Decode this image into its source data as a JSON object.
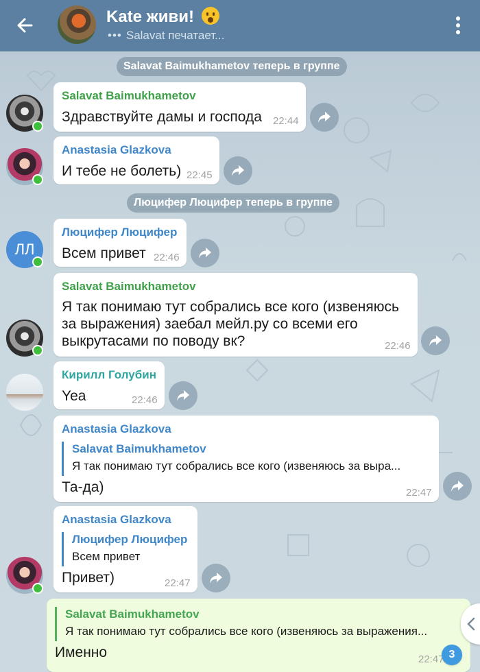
{
  "header": {
    "title": "Kate живи!",
    "status_dots": "•••",
    "status": "Salavat печатает...",
    "colors": {
      "bar": "#5b80a2"
    }
  },
  "service": [
    {
      "text": "Salavat Baimukhametov теперь в группе"
    },
    {
      "text": "Люцифер Люцифер теперь в группе"
    }
  ],
  "messages": [
    {
      "sender": "Salavat Baimukhametov",
      "text": "Здравствуйте дамы и господа",
      "time": "22:44"
    },
    {
      "sender": "Anastasia Glazkova",
      "text": "И тебе не болеть)",
      "time": "22:45"
    },
    {
      "sender": "Люцифер Люцифер",
      "avatar_initials": "ЛЛ",
      "text": "Всем привет",
      "time": "22:46"
    },
    {
      "sender": "Salavat Baimukhametov",
      "lines": [
        "Я так понимаю тут собрались все кого (извеняюсь",
        "за выражения) заебал мейл.ру со всеми его",
        "выкрутасами по поводу вк?"
      ],
      "time": "22:46"
    },
    {
      "sender": "Кирилл Голубин",
      "text": "Yea",
      "time": "22:46"
    },
    {
      "sender": "Anastasia Glazkova",
      "reply_name": "Salavat Baimukhametov",
      "reply_text": "Я так понимаю тут собрались все кого (извеняюсь за выра...",
      "text": "Та-да)",
      "time": "22:47"
    },
    {
      "sender": "Anastasia Glazkova",
      "reply_name": "Люцифер Люцифер",
      "reply_text": "Всем привет",
      "text": "Привет)",
      "time": "22:47"
    },
    {
      "reply_name": "Salavat Baimukhametov",
      "reply_text": "Я так понимаю тут собрались все кого (извеняюсь за выражения...",
      "text": "Именно",
      "time": "22:47"
    }
  ],
  "unread_badge": "3"
}
